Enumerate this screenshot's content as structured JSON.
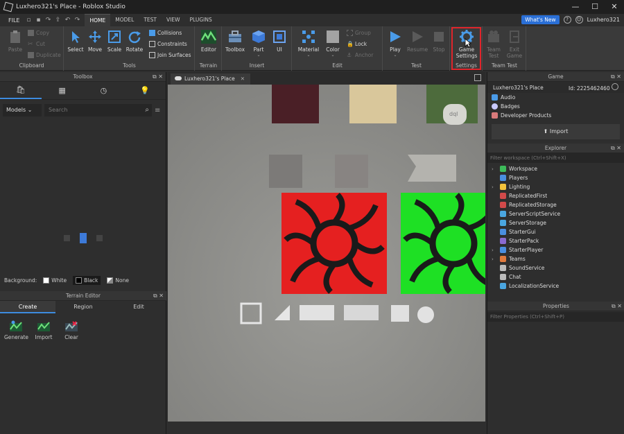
{
  "window": {
    "title": "Luxhero321's Place - Roblox Studio",
    "controls": [
      "—",
      "☐",
      "✕"
    ]
  },
  "menu": {
    "file": "FILE",
    "tabs": [
      "HOME",
      "MODEL",
      "TEST",
      "VIEW",
      "PLUGINS"
    ],
    "active_tab": "HOME",
    "whats_new": "What's New",
    "user": "Luxhero321"
  },
  "ribbon": {
    "clipboard": {
      "label": "Clipboard",
      "paste": "Paste",
      "copy": "Copy",
      "cut": "Cut",
      "duplicate": "Duplicate"
    },
    "tools": {
      "label": "Tools",
      "select": "Select",
      "move": "Move",
      "scale": "Scale",
      "rotate": "Rotate",
      "collisions": "Collisions",
      "constraints": "Constraints",
      "join_surfaces": "Join Surfaces"
    },
    "terrain": {
      "label": "Terrain",
      "editor": "Editor"
    },
    "insert": {
      "label": "Insert",
      "toolbox": "Toolbox",
      "part": "Part",
      "ui": "UI"
    },
    "edit": {
      "label": "Edit",
      "material": "Material",
      "color": "Color",
      "group": "Group",
      "lock": "Lock",
      "anchor": "Anchor"
    },
    "test": {
      "label": "Test",
      "play": "Play",
      "resume": "Resume",
      "stop": "Stop"
    },
    "settings": {
      "label": "Settings",
      "game_settings": "Game Settings"
    },
    "team_test": {
      "label": "Team Test",
      "team_test": "Team Test",
      "exit_game": "Exit Game"
    }
  },
  "toolbox": {
    "title": "Toolbox",
    "category": "Models",
    "search_placeholder": "Search",
    "background_label": "Background:",
    "backgrounds": [
      "White",
      "Black",
      "None"
    ],
    "selected_background": "Black"
  },
  "terrain_editor": {
    "title": "Terrain Editor",
    "tabs": [
      "Create",
      "Region",
      "Edit"
    ],
    "active_tab": "Create",
    "tools": [
      "Generate",
      "Import",
      "Clear"
    ]
  },
  "viewport": {
    "tab": "Luxhero321's Place",
    "tile_text": "dql"
  },
  "game_panel": {
    "title": "Game",
    "place": "Luxhero321's Place",
    "id": "Id: 2225462460",
    "items": [
      "Audio",
      "Badges",
      "Developer Products"
    ],
    "import": "Import"
  },
  "explorer": {
    "title": "Explorer",
    "filter_placeholder": "Filter workspace (Ctrl+Shift+X)",
    "items": [
      {
        "label": "Workspace",
        "expand": true,
        "color": "#3dbb5a"
      },
      {
        "label": "Players",
        "expand": false,
        "color": "#4a8fe0"
      },
      {
        "label": "Lighting",
        "expand": true,
        "color": "#f2c23c"
      },
      {
        "label": "ReplicatedFirst",
        "expand": false,
        "color": "#d24a4a"
      },
      {
        "label": "ReplicatedStorage",
        "expand": false,
        "color": "#d24a4a"
      },
      {
        "label": "ServerScriptService",
        "expand": false,
        "color": "#4aa6e0"
      },
      {
        "label": "ServerStorage",
        "expand": false,
        "color": "#4aa6e0"
      },
      {
        "label": "StarterGui",
        "expand": false,
        "color": "#4a8fe0"
      },
      {
        "label": "StarterPack",
        "expand": false,
        "color": "#8a6ad0"
      },
      {
        "label": "StarterPlayer",
        "expand": true,
        "color": "#4a8fe0"
      },
      {
        "label": "Teams",
        "expand": true,
        "color": "#e07a3d"
      },
      {
        "label": "SoundService",
        "expand": false,
        "color": "#bbbbbb"
      },
      {
        "label": "Chat",
        "expand": false,
        "color": "#bbbbbb"
      },
      {
        "label": "LocalizationService",
        "expand": false,
        "color": "#4aa6e0"
      }
    ]
  },
  "properties": {
    "title": "Properties",
    "filter_placeholder": "Filter Properties (Ctrl+Shift+P)"
  }
}
